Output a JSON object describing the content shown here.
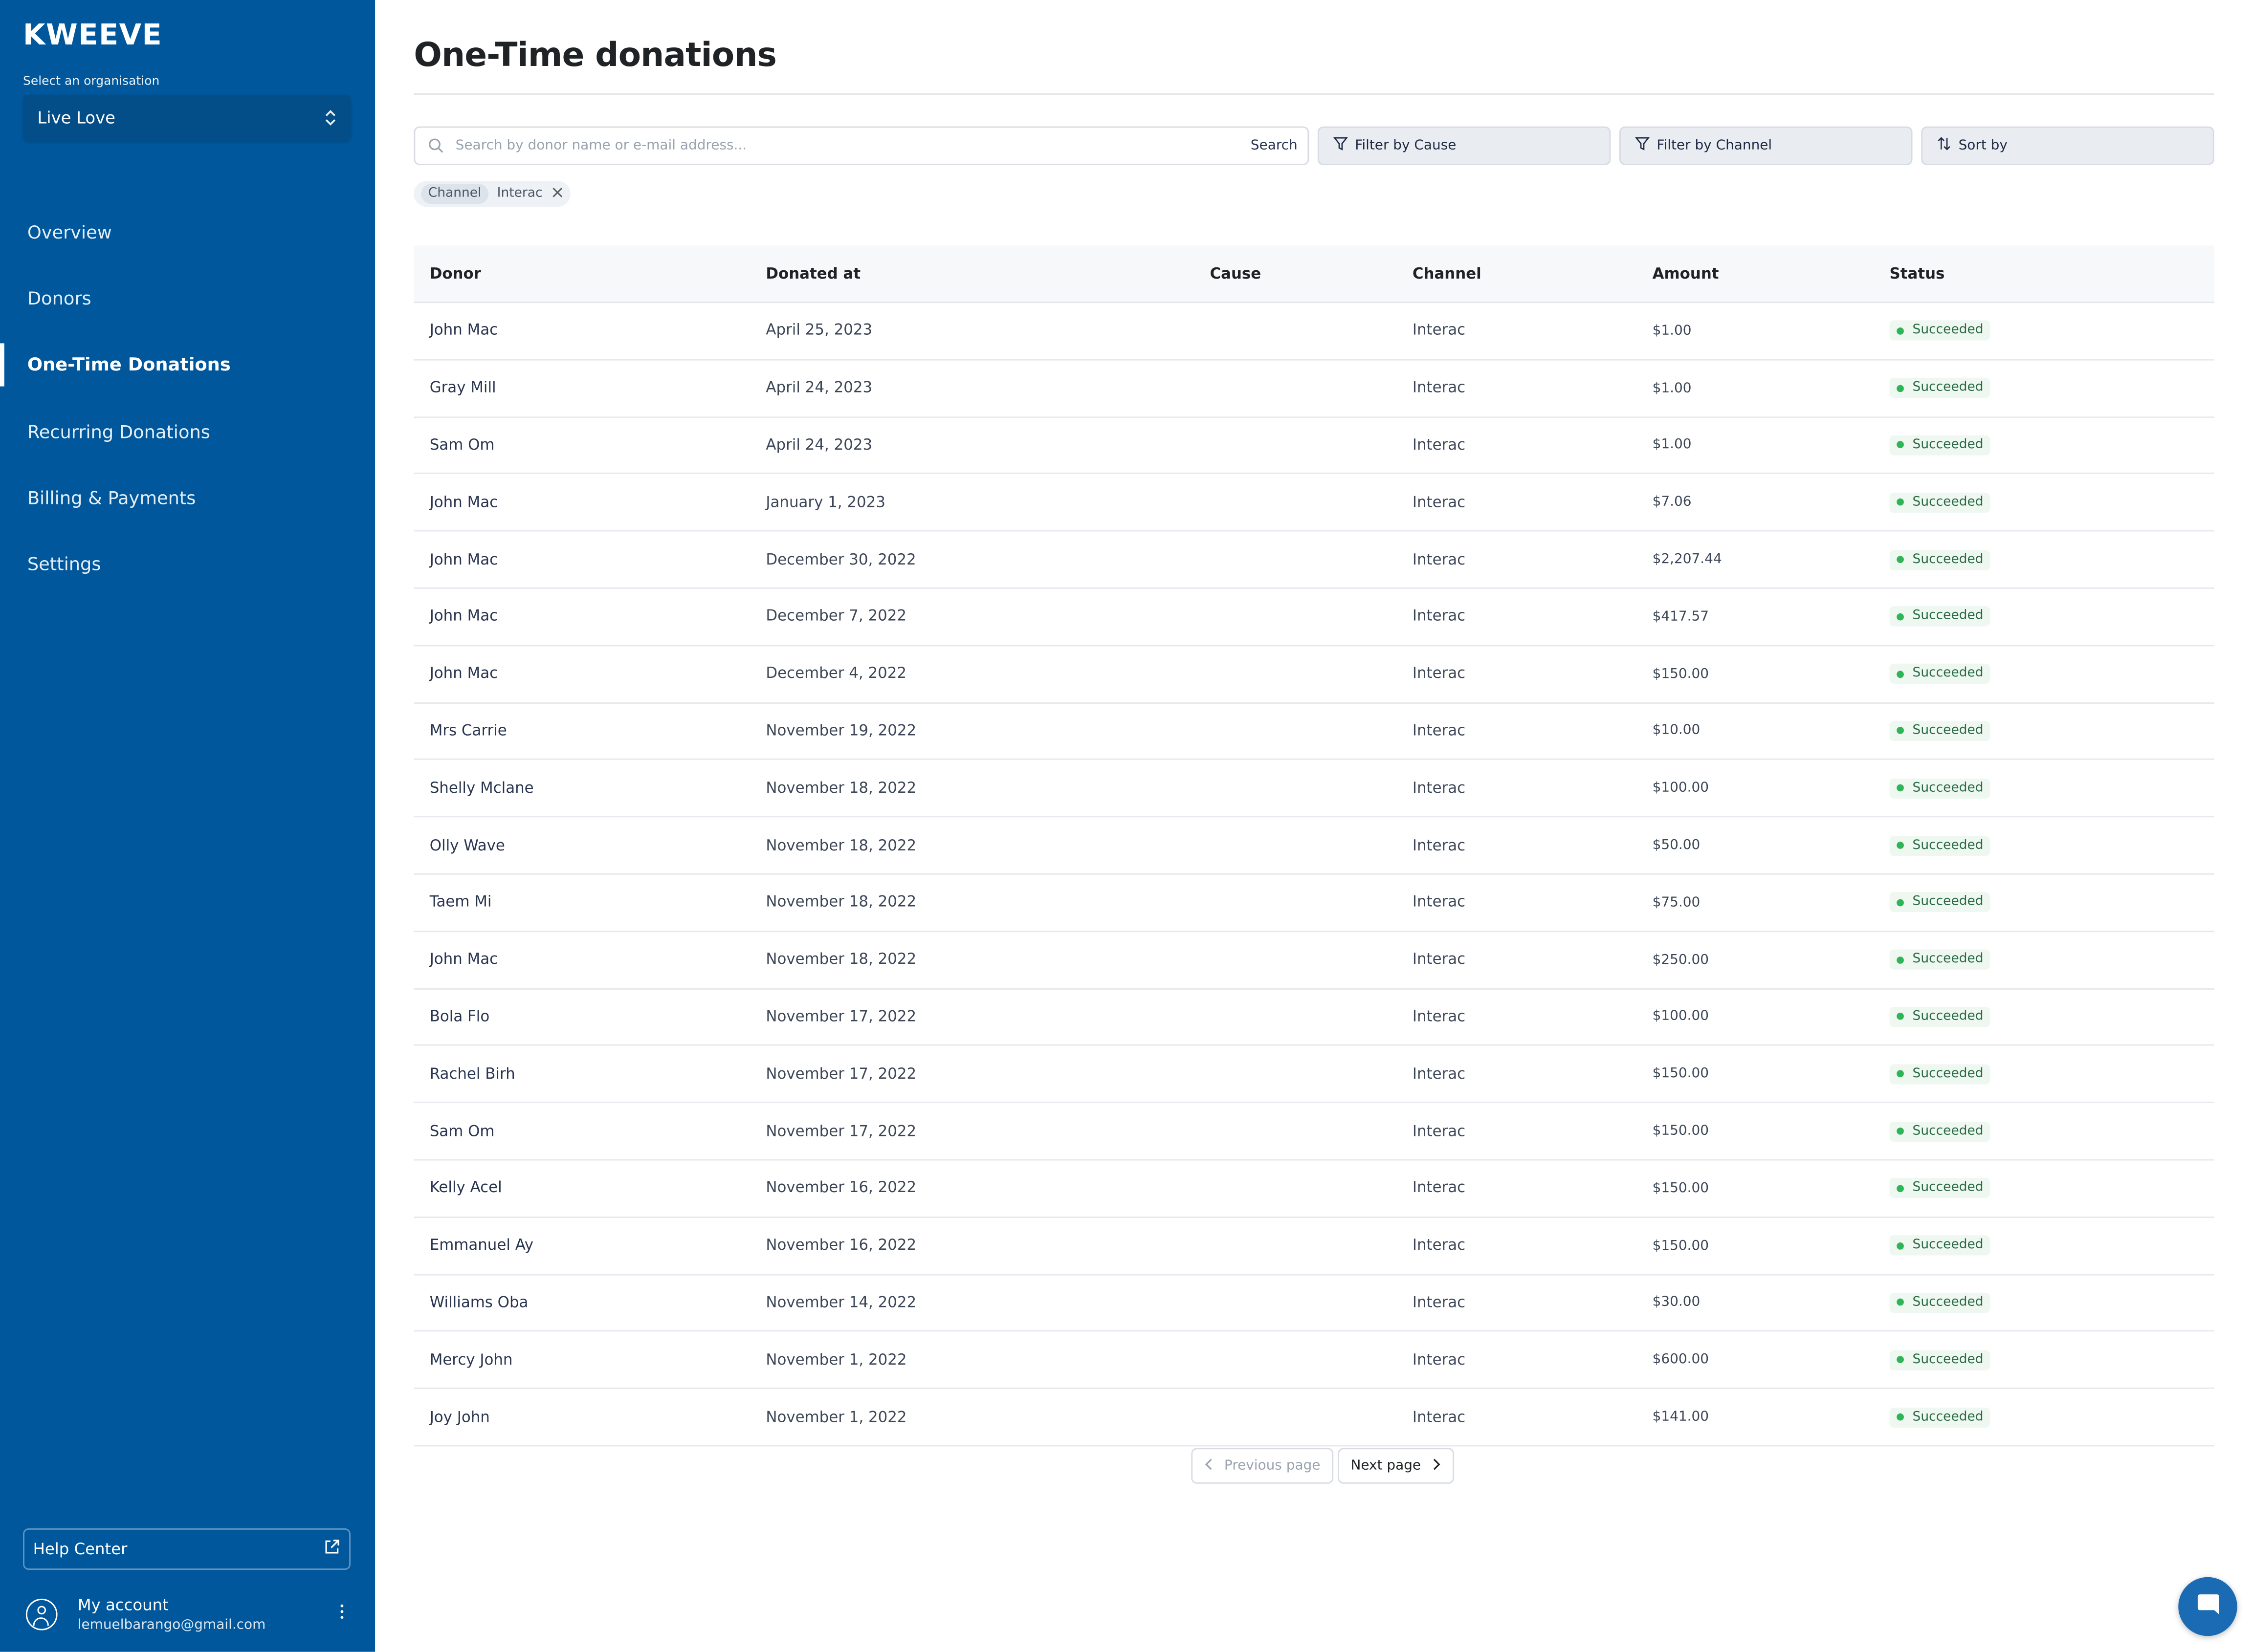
{
  "app": {
    "logo": "KWEEVE",
    "org_label": "Select an organisation",
    "org_selected": "Live Love"
  },
  "nav": {
    "items": [
      {
        "label": "Overview"
      },
      {
        "label": "Donors"
      },
      {
        "label": "One-Time Donations",
        "active": true
      },
      {
        "label": "Recurring Donations"
      },
      {
        "label": "Billing & Payments"
      },
      {
        "label": "Settings"
      }
    ]
  },
  "help": {
    "label": "Help Center"
  },
  "account": {
    "title": "My account",
    "email": "lemuelbarango@gmail.com"
  },
  "page": {
    "title": "One-Time donations"
  },
  "search": {
    "placeholder": "Search by donor name or e-mail address...",
    "button": "Search"
  },
  "filters": {
    "cause": "Filter by Cause",
    "channel": "Filter by Channel",
    "sort": "Sort by"
  },
  "active_filter": {
    "key": "Channel",
    "value": "Interac"
  },
  "table": {
    "headers": [
      "Donor",
      "Donated at",
      "Cause",
      "Channel",
      "Amount",
      "Status"
    ],
    "rows": [
      {
        "donor": "John Mac",
        "date": "April 25, 2023",
        "cause": "",
        "channel": "Interac",
        "amount": "$1.00",
        "status": "Succeeded"
      },
      {
        "donor": "Gray Mill",
        "date": "April 24, 2023",
        "cause": "",
        "channel": "Interac",
        "amount": "$1.00",
        "status": "Succeeded"
      },
      {
        "donor": "Sam Om",
        "date": "April 24, 2023",
        "cause": "",
        "channel": "Interac",
        "amount": "$1.00",
        "status": "Succeeded"
      },
      {
        "donor": "John Mac",
        "date": "January 1, 2023",
        "cause": "",
        "channel": "Interac",
        "amount": "$7.06",
        "status": "Succeeded"
      },
      {
        "donor": "John Mac",
        "date": "December 30, 2022",
        "cause": "",
        "channel": "Interac",
        "amount": "$2,207.44",
        "status": "Succeeded"
      },
      {
        "donor": "John Mac",
        "date": "December 7, 2022",
        "cause": "",
        "channel": "Interac",
        "amount": "$417.57",
        "status": "Succeeded"
      },
      {
        "donor": "John Mac",
        "date": "December 4, 2022",
        "cause": "",
        "channel": "Interac",
        "amount": "$150.00",
        "status": "Succeeded"
      },
      {
        "donor": "Mrs Carrie",
        "date": "November 19, 2022",
        "cause": "",
        "channel": "Interac",
        "amount": "$10.00",
        "status": "Succeeded"
      },
      {
        "donor": "Shelly Mclane",
        "date": "November 18, 2022",
        "cause": "",
        "channel": "Interac",
        "amount": "$100.00",
        "status": "Succeeded"
      },
      {
        "donor": "Olly Wave",
        "date": "November 18, 2022",
        "cause": "",
        "channel": "Interac",
        "amount": "$50.00",
        "status": "Succeeded"
      },
      {
        "donor": "Taem Mi",
        "date": "November 18, 2022",
        "cause": "",
        "channel": "Interac",
        "amount": "$75.00",
        "status": "Succeeded"
      },
      {
        "donor": "John Mac",
        "date": "November 18, 2022",
        "cause": "",
        "channel": "Interac",
        "amount": "$250.00",
        "status": "Succeeded"
      },
      {
        "donor": "Bola Flo",
        "date": "November 17, 2022",
        "cause": "",
        "channel": "Interac",
        "amount": "$100.00",
        "status": "Succeeded"
      },
      {
        "donor": "Rachel Birh",
        "date": "November 17, 2022",
        "cause": "",
        "channel": "Interac",
        "amount": "$150.00",
        "status": "Succeeded"
      },
      {
        "donor": "Sam Om",
        "date": "November 17, 2022",
        "cause": "",
        "channel": "Interac",
        "amount": "$150.00",
        "status": "Succeeded"
      },
      {
        "donor": "Kelly Acel",
        "date": "November 16, 2022",
        "cause": "",
        "channel": "Interac",
        "amount": "$150.00",
        "status": "Succeeded"
      },
      {
        "donor": "Emmanuel Ay",
        "date": "November 16, 2022",
        "cause": "",
        "channel": "Interac",
        "amount": "$150.00",
        "status": "Succeeded"
      },
      {
        "donor": "Williams Oba",
        "date": "November 14, 2022",
        "cause": "",
        "channel": "Interac",
        "amount": "$30.00",
        "status": "Succeeded"
      },
      {
        "donor": "Mercy John",
        "date": "November 1, 2022",
        "cause": "",
        "channel": "Interac",
        "amount": "$600.00",
        "status": "Succeeded"
      },
      {
        "donor": "Joy John",
        "date": "November 1, 2022",
        "cause": "",
        "channel": "Interac",
        "amount": "$141.00",
        "status": "Succeeded"
      }
    ]
  },
  "pagination": {
    "prev": "Previous page",
    "next": "Next page"
  },
  "colors": {
    "sidebar": "#00579b",
    "status_green": "#2fb457",
    "chat": "#1a6bb3"
  },
  "icons": [
    "updown-chevron-icon",
    "external-link-icon",
    "user-circle-icon",
    "more-vertical-icon",
    "search-icon",
    "filter-icon",
    "sort-icon",
    "close-icon",
    "chevron-left-icon",
    "chevron-right-icon",
    "chat-icon"
  ]
}
